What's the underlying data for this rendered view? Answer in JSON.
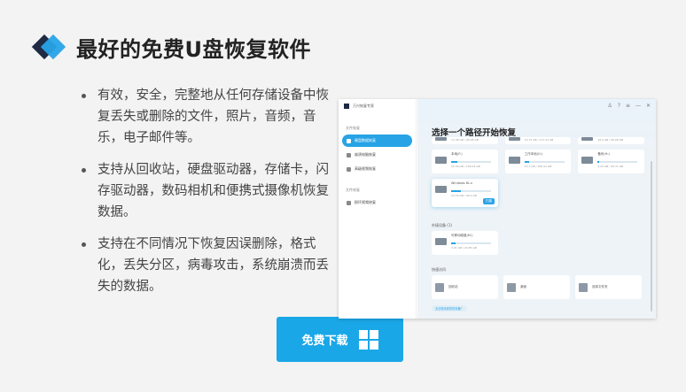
{
  "heading": {
    "title": "最好的免费U盘恢复软件"
  },
  "features": [
    "有效，安全，完整地从任何存储设备中恢复丢失或删除的文件，照片，音频，音乐，电子邮件等。",
    "支持从回收站，硬盘驱动器，存储卡，闪存驱动器，数码相机和便携式摄像机恢复数据。",
    "支持在不同情况下恢复因误删除，格式化，丢失分区，病毒攻击，系统崩溃而丢失的数据。"
  ],
  "download": {
    "label": "免费下载"
  },
  "app": {
    "title": "万兴恢复专家",
    "sidebar": {
      "section1": "文件恢复",
      "section2": "文件修复",
      "items": [
        {
          "label": "硬盘数据恢复",
          "active": true
        },
        {
          "label": "崩溃电脑恢复",
          "active": false
        },
        {
          "label": "高级视频恢复",
          "active": false
        },
        {
          "label": "损坏视频修复",
          "active": false
        }
      ]
    },
    "main_title": "选择一个路径开始恢复",
    "drives_partial": [
      {
        "meta": "13.38 GB / 99.08 GB",
        "fill": 0.13
      },
      {
        "meta": "13.72 GB / 117.31 GB",
        "fill": 0.12
      },
      {
        "meta": "18.4 GB / 99.08 GB",
        "fill": 0.19
      }
    ],
    "drives": [
      {
        "name": "本地(F:)",
        "meta": "29.39 GB / 199.03 GB",
        "fill": 0.15
      },
      {
        "name": "工作本地(G:)",
        "meta": "23.7 GB / 200.91 GB",
        "fill": 0.12
      },
      {
        "name": "备份(H:)",
        "meta": "3.93 GB / 99.31 GB",
        "fill": 0.04
      }
    ],
    "highlight_drive": {
      "name": "Windows 8L.x",
      "meta": "24.79 GB / 99.0 GB",
      "chip": "扫描",
      "fill": 0.25
    },
    "external_label": "外接设备 (1)",
    "external_drive": {
      "name": "可移动磁盘(M:)",
      "meta": "3.01 GB / 29.85 GB",
      "fill": 0.1
    },
    "quick_label": "快速访问",
    "quick": [
      {
        "label": "回收站"
      },
      {
        "label": "桌面"
      },
      {
        "label": "选择文件夹"
      }
    ],
    "help": "无法检测到您的设备？"
  }
}
